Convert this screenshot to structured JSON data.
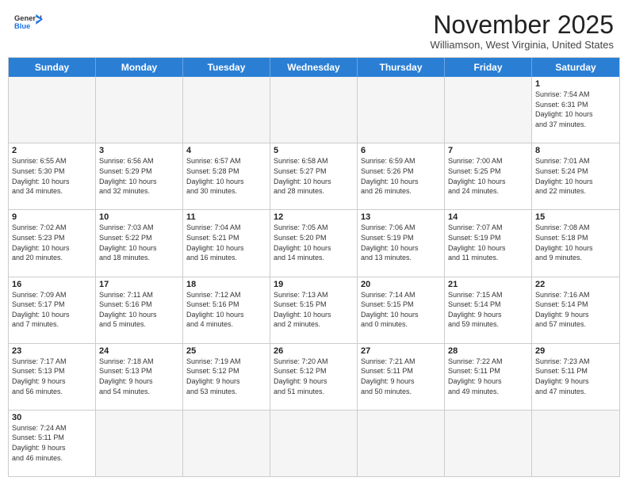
{
  "header": {
    "logo_general": "General",
    "logo_blue": "Blue",
    "month_title": "November 2025",
    "location": "Williamson, West Virginia, United States"
  },
  "day_headers": [
    "Sunday",
    "Monday",
    "Tuesday",
    "Wednesday",
    "Thursday",
    "Friday",
    "Saturday"
  ],
  "weeks": [
    [
      {
        "num": "",
        "info": "",
        "empty": true
      },
      {
        "num": "",
        "info": "",
        "empty": true
      },
      {
        "num": "",
        "info": "",
        "empty": true
      },
      {
        "num": "",
        "info": "",
        "empty": true
      },
      {
        "num": "",
        "info": "",
        "empty": true
      },
      {
        "num": "",
        "info": "",
        "empty": true
      },
      {
        "num": "1",
        "info": "Sunrise: 7:54 AM\nSunset: 6:31 PM\nDaylight: 10 hours\nand 37 minutes.",
        "empty": false
      }
    ],
    [
      {
        "num": "2",
        "info": "Sunrise: 6:55 AM\nSunset: 5:30 PM\nDaylight: 10 hours\nand 34 minutes.",
        "empty": false
      },
      {
        "num": "3",
        "info": "Sunrise: 6:56 AM\nSunset: 5:29 PM\nDaylight: 10 hours\nand 32 minutes.",
        "empty": false
      },
      {
        "num": "4",
        "info": "Sunrise: 6:57 AM\nSunset: 5:28 PM\nDaylight: 10 hours\nand 30 minutes.",
        "empty": false
      },
      {
        "num": "5",
        "info": "Sunrise: 6:58 AM\nSunset: 5:27 PM\nDaylight: 10 hours\nand 28 minutes.",
        "empty": false
      },
      {
        "num": "6",
        "info": "Sunrise: 6:59 AM\nSunset: 5:26 PM\nDaylight: 10 hours\nand 26 minutes.",
        "empty": false
      },
      {
        "num": "7",
        "info": "Sunrise: 7:00 AM\nSunset: 5:25 PM\nDaylight: 10 hours\nand 24 minutes.",
        "empty": false
      },
      {
        "num": "8",
        "info": "Sunrise: 7:01 AM\nSunset: 5:24 PM\nDaylight: 10 hours\nand 22 minutes.",
        "empty": false
      }
    ],
    [
      {
        "num": "9",
        "info": "Sunrise: 7:02 AM\nSunset: 5:23 PM\nDaylight: 10 hours\nand 20 minutes.",
        "empty": false
      },
      {
        "num": "10",
        "info": "Sunrise: 7:03 AM\nSunset: 5:22 PM\nDaylight: 10 hours\nand 18 minutes.",
        "empty": false
      },
      {
        "num": "11",
        "info": "Sunrise: 7:04 AM\nSunset: 5:21 PM\nDaylight: 10 hours\nand 16 minutes.",
        "empty": false
      },
      {
        "num": "12",
        "info": "Sunrise: 7:05 AM\nSunset: 5:20 PM\nDaylight: 10 hours\nand 14 minutes.",
        "empty": false
      },
      {
        "num": "13",
        "info": "Sunrise: 7:06 AM\nSunset: 5:19 PM\nDaylight: 10 hours\nand 13 minutes.",
        "empty": false
      },
      {
        "num": "14",
        "info": "Sunrise: 7:07 AM\nSunset: 5:19 PM\nDaylight: 10 hours\nand 11 minutes.",
        "empty": false
      },
      {
        "num": "15",
        "info": "Sunrise: 7:08 AM\nSunset: 5:18 PM\nDaylight: 10 hours\nand 9 minutes.",
        "empty": false
      }
    ],
    [
      {
        "num": "16",
        "info": "Sunrise: 7:09 AM\nSunset: 5:17 PM\nDaylight: 10 hours\nand 7 minutes.",
        "empty": false
      },
      {
        "num": "17",
        "info": "Sunrise: 7:11 AM\nSunset: 5:16 PM\nDaylight: 10 hours\nand 5 minutes.",
        "empty": false
      },
      {
        "num": "18",
        "info": "Sunrise: 7:12 AM\nSunset: 5:16 PM\nDaylight: 10 hours\nand 4 minutes.",
        "empty": false
      },
      {
        "num": "19",
        "info": "Sunrise: 7:13 AM\nSunset: 5:15 PM\nDaylight: 10 hours\nand 2 minutes.",
        "empty": false
      },
      {
        "num": "20",
        "info": "Sunrise: 7:14 AM\nSunset: 5:15 PM\nDaylight: 10 hours\nand 0 minutes.",
        "empty": false
      },
      {
        "num": "21",
        "info": "Sunrise: 7:15 AM\nSunset: 5:14 PM\nDaylight: 9 hours\nand 59 minutes.",
        "empty": false
      },
      {
        "num": "22",
        "info": "Sunrise: 7:16 AM\nSunset: 5:14 PM\nDaylight: 9 hours\nand 57 minutes.",
        "empty": false
      }
    ],
    [
      {
        "num": "23",
        "info": "Sunrise: 7:17 AM\nSunset: 5:13 PM\nDaylight: 9 hours\nand 56 minutes.",
        "empty": false
      },
      {
        "num": "24",
        "info": "Sunrise: 7:18 AM\nSunset: 5:13 PM\nDaylight: 9 hours\nand 54 minutes.",
        "empty": false
      },
      {
        "num": "25",
        "info": "Sunrise: 7:19 AM\nSunset: 5:12 PM\nDaylight: 9 hours\nand 53 minutes.",
        "empty": false
      },
      {
        "num": "26",
        "info": "Sunrise: 7:20 AM\nSunset: 5:12 PM\nDaylight: 9 hours\nand 51 minutes.",
        "empty": false
      },
      {
        "num": "27",
        "info": "Sunrise: 7:21 AM\nSunset: 5:11 PM\nDaylight: 9 hours\nand 50 minutes.",
        "empty": false
      },
      {
        "num": "28",
        "info": "Sunrise: 7:22 AM\nSunset: 5:11 PM\nDaylight: 9 hours\nand 49 minutes.",
        "empty": false
      },
      {
        "num": "29",
        "info": "Sunrise: 7:23 AM\nSunset: 5:11 PM\nDaylight: 9 hours\nand 47 minutes.",
        "empty": false
      }
    ],
    [
      {
        "num": "30",
        "info": "Sunrise: 7:24 AM\nSunset: 5:11 PM\nDaylight: 9 hours\nand 46 minutes.",
        "empty": false
      },
      {
        "num": "",
        "info": "",
        "empty": true
      },
      {
        "num": "",
        "info": "",
        "empty": true
      },
      {
        "num": "",
        "info": "",
        "empty": true
      },
      {
        "num": "",
        "info": "",
        "empty": true
      },
      {
        "num": "",
        "info": "",
        "empty": true
      },
      {
        "num": "",
        "info": "",
        "empty": true
      }
    ]
  ]
}
